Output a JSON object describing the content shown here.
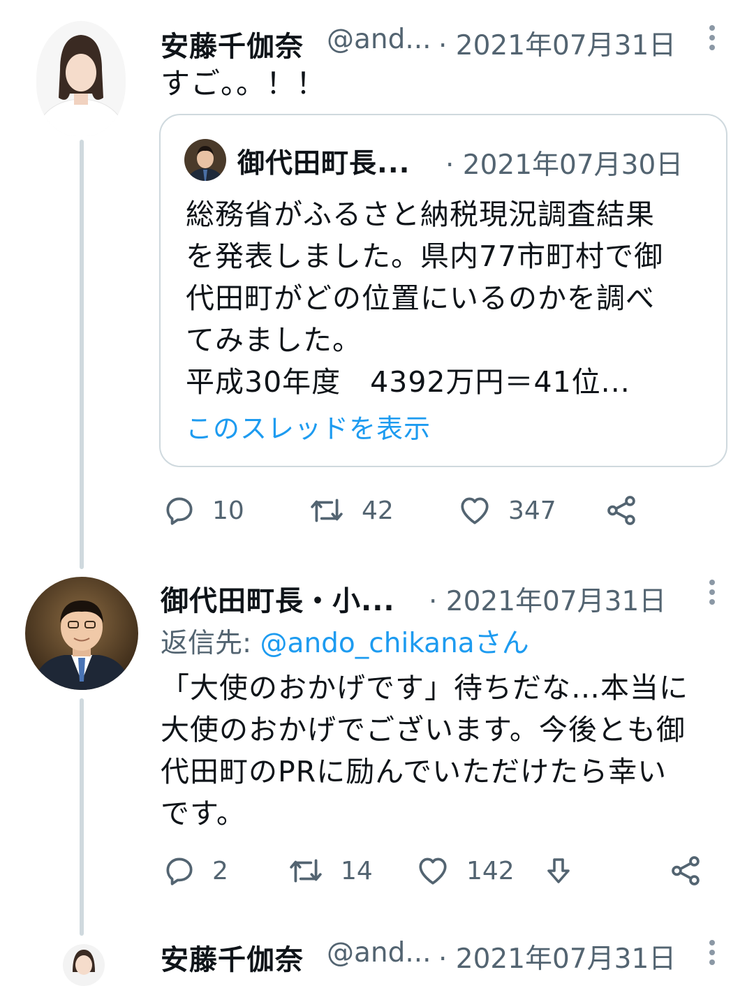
{
  "tweet1": {
    "name": "安藤千伽奈",
    "handle": "@and...",
    "date": "· 2021年07月31日",
    "text": "すご。。！！",
    "quote": {
      "name": "御代田町長...",
      "date": "· 2021年07月30日",
      "lines": [
        "総務省がふるさと納税現況調査結果",
        "を発表しました。県内77市町村で御",
        "代田町がどの位置にいるのかを調べ",
        "てみました。",
        "平成30年度　4392万円＝41位..."
      ],
      "show_thread": "このスレッドを表示"
    },
    "actions": {
      "replies": "10",
      "retweets": "42",
      "likes": "347"
    }
  },
  "tweet2": {
    "name": "御代田町長・小...",
    "date": "· 2021年07月31日",
    "reply_to_prefix": "返信先: ",
    "reply_to_handle": "@ando_chikanaさん",
    "lines": [
      "「大使のおかげです」待ちだな…本当に",
      "大使のおかげでございます。今後とも御",
      "代田町のPRに励んでいただけたら幸い",
      "です。"
    ],
    "actions": {
      "replies": "2",
      "retweets": "14",
      "likes": "142"
    }
  },
  "tweet3": {
    "name": "安藤千伽奈",
    "handle": "@and...",
    "date": "· 2021年07月31日"
  },
  "colors": {
    "link": "#1d9bf0",
    "secondary": "#536471",
    "thread": "#cfd9de"
  }
}
